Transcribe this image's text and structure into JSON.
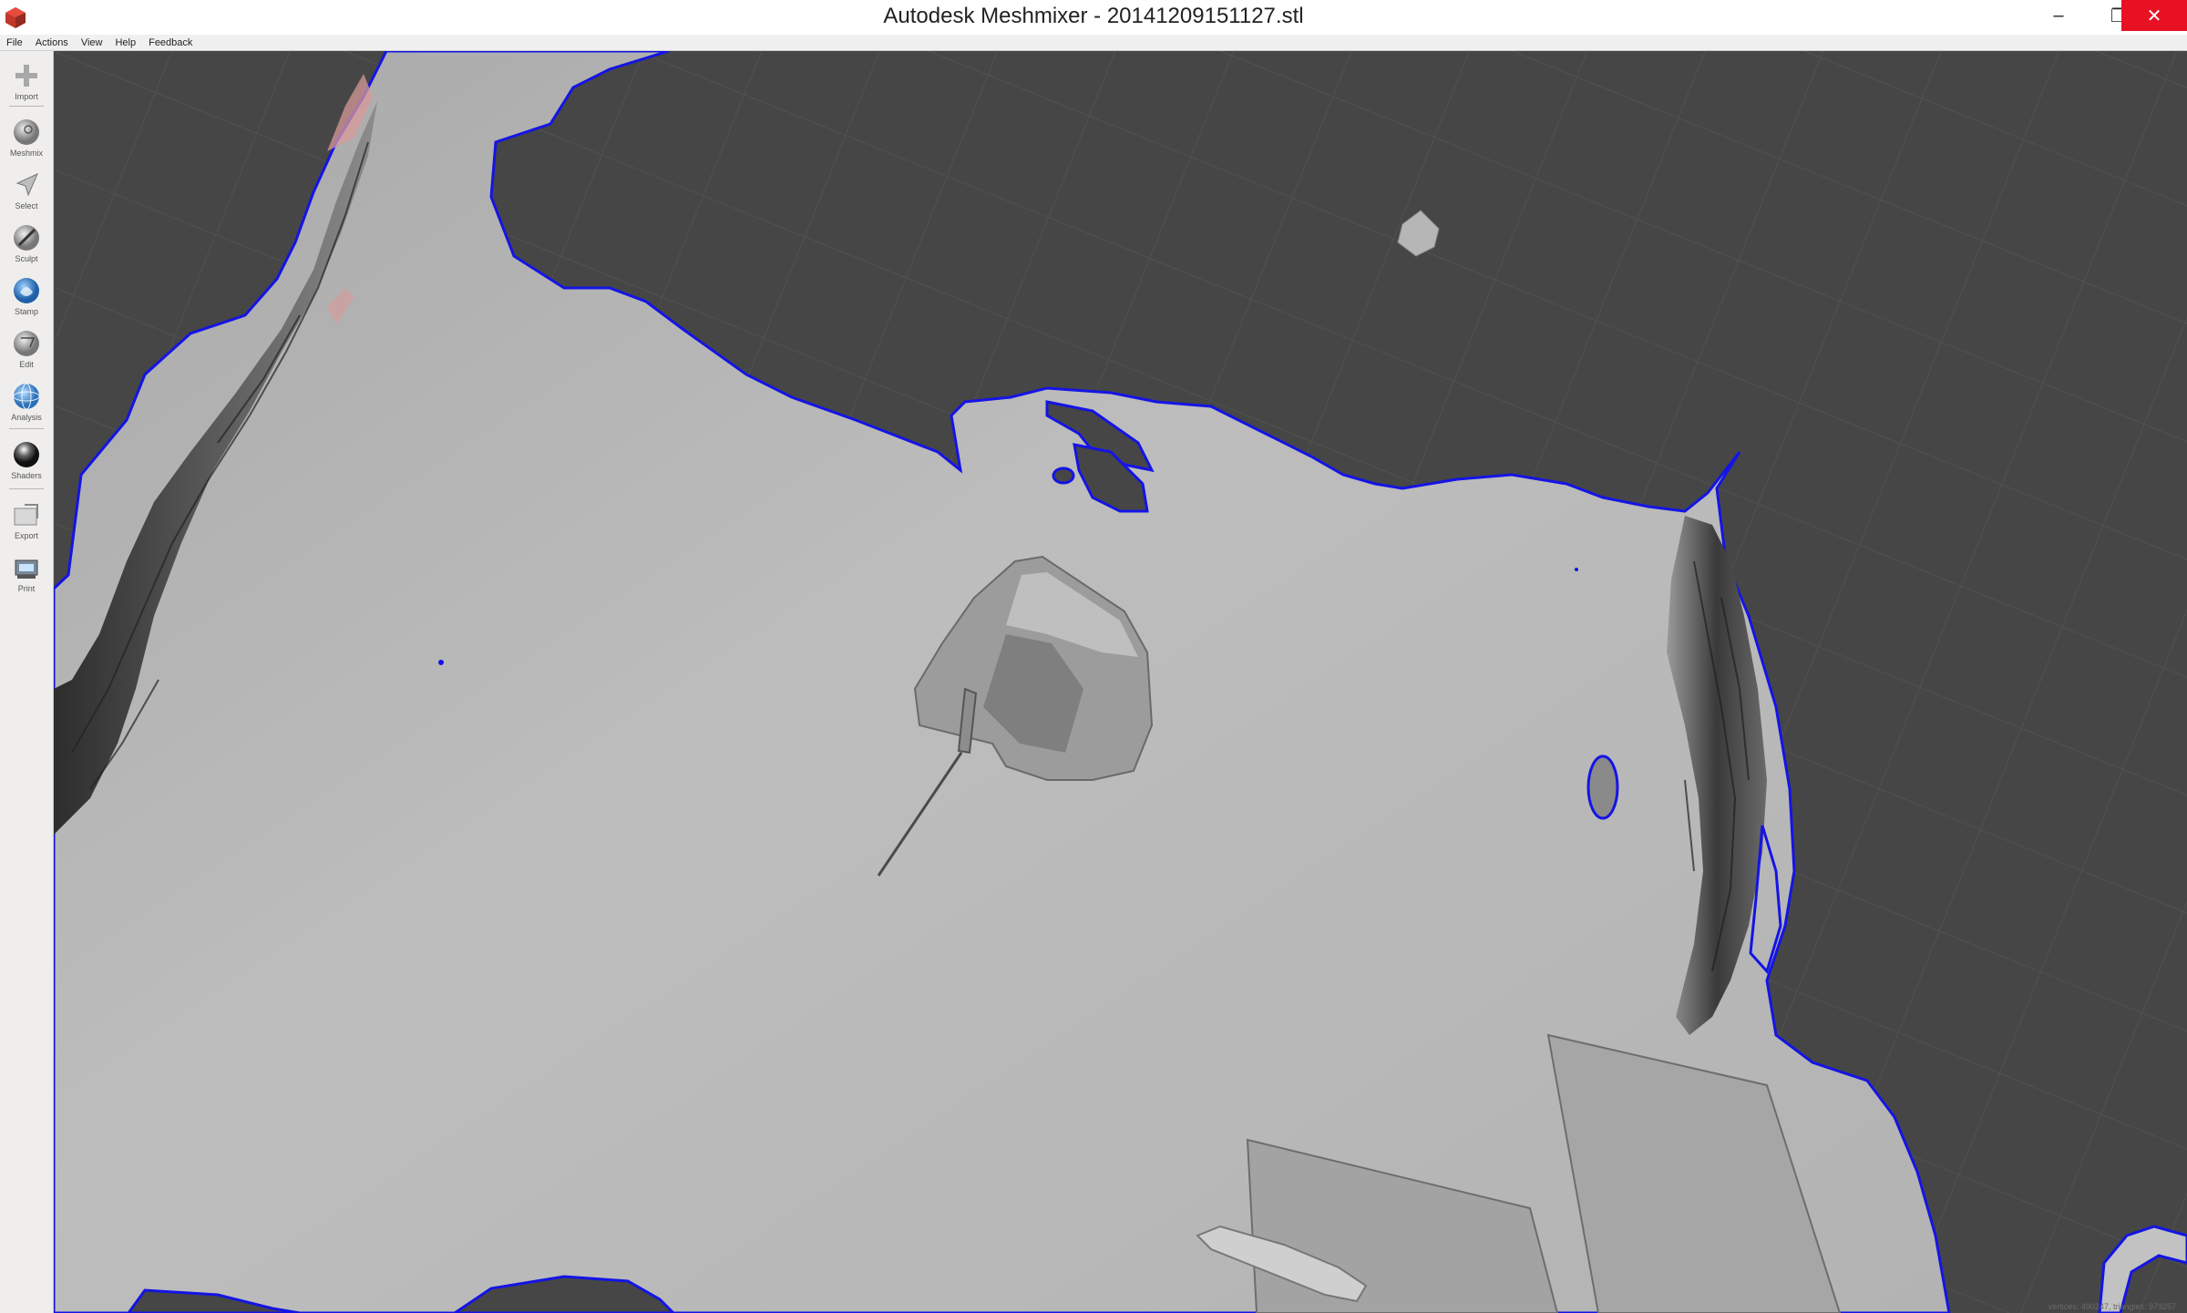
{
  "window": {
    "title": "Autodesk Meshmixer - 20141209151127.stl",
    "minimize_glyph": "–",
    "maximize_glyph": "❐",
    "close_glyph": "✕"
  },
  "menu": {
    "items": [
      "File",
      "Actions",
      "View",
      "Help",
      "Feedback"
    ]
  },
  "toolbar": {
    "tools": [
      {
        "label": "Import",
        "icon": "plus-icon"
      },
      {
        "label": "Meshmix",
        "icon": "meshmix-ball-icon"
      },
      {
        "label": "Select",
        "icon": "arrow-cursor-icon"
      },
      {
        "label": "Sculpt",
        "icon": "brush-icon"
      },
      {
        "label": "Stamp",
        "icon": "stamp-icon"
      },
      {
        "label": "Edit",
        "icon": "edit-ball-icon"
      },
      {
        "label": "Analysis",
        "icon": "wireframe-sphere-icon"
      },
      {
        "label": "Shaders",
        "icon": "shader-sphere-icon"
      },
      {
        "label": "Export",
        "icon": "folder-export-icon"
      },
      {
        "label": "Print",
        "icon": "printer-icon"
      }
    ]
  },
  "status": {
    "text": "vertices: 490247, triangles: 979257"
  },
  "colors": {
    "viewport_bg": "#464646",
    "grid_line": "#555555",
    "mesh": "#b9b9b9",
    "boundary": "#1414e6",
    "close_button": "#e81123"
  }
}
